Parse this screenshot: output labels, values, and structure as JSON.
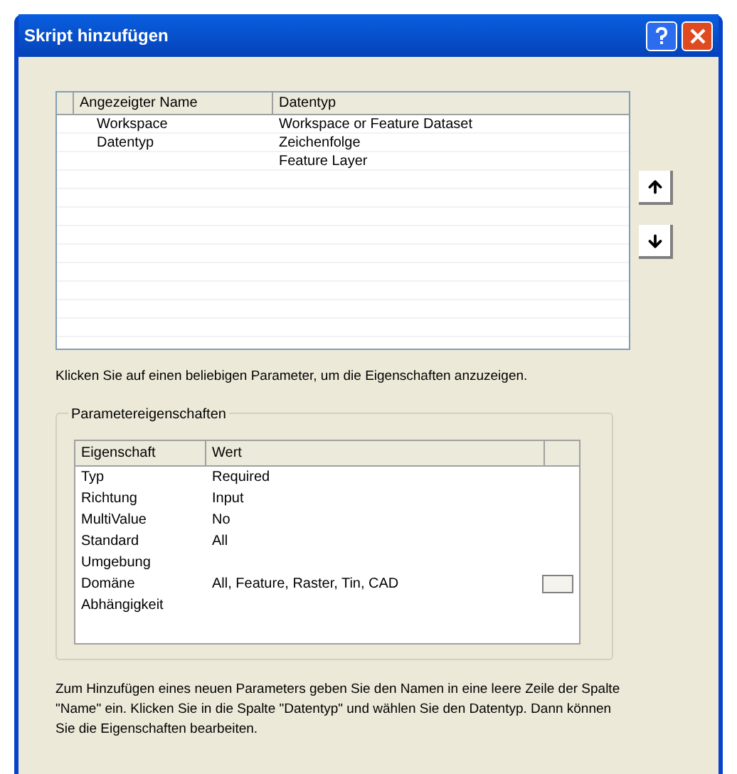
{
  "window": {
    "title": "Skript hinzufügen"
  },
  "parameters": {
    "columns": [
      "Angezeigter Name",
      "Datentyp"
    ],
    "rows": [
      {
        "name": "Workspace",
        "type": "Workspace or Feature Dataset"
      },
      {
        "name": "Datentyp",
        "type": "Zeichenfolge"
      },
      {
        "type": "Feature Layer"
      }
    ]
  },
  "hint": "Klicken Sie auf einen beliebigen Parameter, um die Eigenschaften anzuzeigen.",
  "properties": {
    "title": "Parametereigenschaften",
    "columns": [
      "Eigenschaft",
      "Wert"
    ],
    "rows": [
      {
        "name": "Typ",
        "value": "Required",
        "kind": "text"
      },
      {
        "name": "Richtung",
        "value": "Input",
        "kind": "text"
      },
      {
        "name": "MultiValue",
        "value": "No",
        "kind": "text"
      },
      {
        "name": "Standard",
        "value": "All",
        "kind": "text"
      },
      {
        "name": "Umgebung",
        "kind": "text"
      },
      {
        "name": "Domäne",
        "value": "All, Feature, Raster, Tin, CAD",
        "kind": "browse"
      },
      {
        "name": "Abhängigkeit",
        "kind": "text"
      }
    ]
  },
  "footer": "Zum Hinzufügen eines neuen Parameters geben Sie den Namen in eine leere Zeile der Spalte \"Name\" ein. Klicken Sie in die Spalte \"Datentyp\" und wählen Sie den Datentyp. Dann können Sie die Eigenschaften bearbeiten."
}
